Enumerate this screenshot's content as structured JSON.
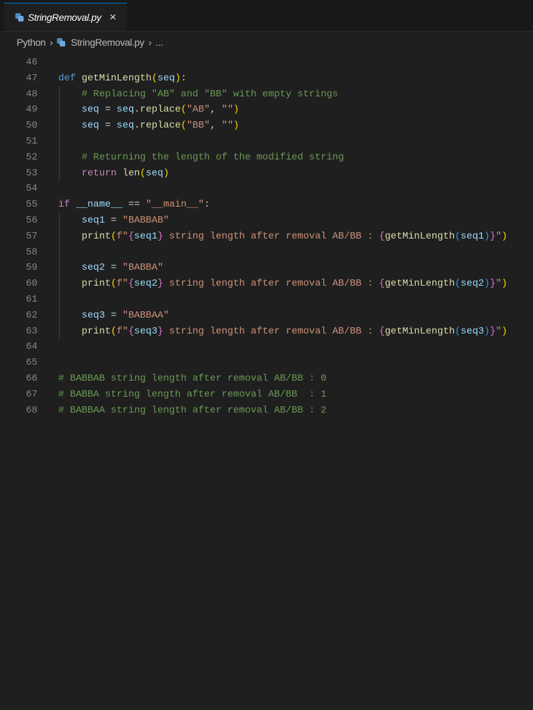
{
  "tab": {
    "filename": "StringRemoval.py",
    "close_icon": "×"
  },
  "breadcrumb": {
    "items": [
      "Python",
      "StringRemoval.py",
      "..."
    ],
    "separator": "›"
  },
  "code": {
    "lines": [
      {
        "n": "46",
        "tokens": []
      },
      {
        "n": "47",
        "tokens": [
          [
            "def",
            "kw"
          ],
          [
            " ",
            "op"
          ],
          [
            "getMinLength",
            "fn"
          ],
          [
            "(",
            "b1"
          ],
          [
            "seq",
            "var"
          ],
          [
            ")",
            "b1"
          ],
          [
            ":",
            "op"
          ]
        ]
      },
      {
        "n": "48",
        "guide": true,
        "tokens": [
          [
            "    ",
            "op"
          ],
          [
            "# Replacing \"AB\" and \"BB\" with empty strings",
            "cm"
          ]
        ]
      },
      {
        "n": "49",
        "guide": true,
        "tokens": [
          [
            "    ",
            "op"
          ],
          [
            "seq",
            "var"
          ],
          [
            " = ",
            "op"
          ],
          [
            "seq",
            "var"
          ],
          [
            ".",
            "op"
          ],
          [
            "replace",
            "fn"
          ],
          [
            "(",
            "b1"
          ],
          [
            "\"AB\"",
            "str"
          ],
          [
            ", ",
            "op"
          ],
          [
            "\"\"",
            "str"
          ],
          [
            ")",
            "b1"
          ]
        ]
      },
      {
        "n": "50",
        "guide": true,
        "tokens": [
          [
            "    ",
            "op"
          ],
          [
            "seq",
            "var"
          ],
          [
            " = ",
            "op"
          ],
          [
            "seq",
            "var"
          ],
          [
            ".",
            "op"
          ],
          [
            "replace",
            "fn"
          ],
          [
            "(",
            "b1"
          ],
          [
            "\"BB\"",
            "str"
          ],
          [
            ", ",
            "op"
          ],
          [
            "\"\"",
            "str"
          ],
          [
            ")",
            "b1"
          ]
        ]
      },
      {
        "n": "51",
        "guide": true,
        "tokens": []
      },
      {
        "n": "52",
        "guide": true,
        "tokens": [
          [
            "    ",
            "op"
          ],
          [
            "# Returning the length of the modified string",
            "cm"
          ]
        ]
      },
      {
        "n": "53",
        "guide": true,
        "tokens": [
          [
            "    ",
            "op"
          ],
          [
            "return",
            "ctl"
          ],
          [
            " ",
            "op"
          ],
          [
            "len",
            "fn"
          ],
          [
            "(",
            "b1"
          ],
          [
            "seq",
            "var"
          ],
          [
            ")",
            "b1"
          ]
        ]
      },
      {
        "n": "54",
        "tokens": []
      },
      {
        "n": "55",
        "tokens": [
          [
            "if",
            "ctl"
          ],
          [
            " ",
            "op"
          ],
          [
            "__name__",
            "var"
          ],
          [
            " == ",
            "op"
          ],
          [
            "\"__main__\"",
            "str"
          ],
          [
            ":",
            "op"
          ]
        ]
      },
      {
        "n": "56",
        "guide": true,
        "tokens": [
          [
            "    ",
            "op"
          ],
          [
            "seq1",
            "var"
          ],
          [
            " = ",
            "op"
          ],
          [
            "\"BABBAB\"",
            "str"
          ]
        ]
      },
      {
        "n": "57",
        "guide": true,
        "tokens": [
          [
            "    ",
            "op"
          ],
          [
            "print",
            "fn"
          ],
          [
            "(",
            "b1"
          ],
          [
            "f\"",
            "str"
          ],
          [
            "{",
            "b2"
          ],
          [
            "seq1",
            "var"
          ],
          [
            "}",
            "b2"
          ],
          [
            " string length after removal AB/BB : ",
            "str"
          ],
          [
            "{",
            "b2"
          ],
          [
            "getMinLength",
            "fn"
          ],
          [
            "(",
            "b3"
          ],
          [
            "seq1",
            "var"
          ],
          [
            ")",
            "b3"
          ],
          [
            "}",
            "b2"
          ],
          [
            "\"",
            "str"
          ],
          [
            ")",
            "b1"
          ]
        ]
      },
      {
        "n": "58",
        "guide": true,
        "tokens": []
      },
      {
        "n": "59",
        "guide": true,
        "tokens": [
          [
            "    ",
            "op"
          ],
          [
            "seq2",
            "var"
          ],
          [
            " = ",
            "op"
          ],
          [
            "\"BABBA\"",
            "str"
          ]
        ]
      },
      {
        "n": "60",
        "guide": true,
        "tokens": [
          [
            "    ",
            "op"
          ],
          [
            "print",
            "fn"
          ],
          [
            "(",
            "b1"
          ],
          [
            "f\"",
            "str"
          ],
          [
            "{",
            "b2"
          ],
          [
            "seq2",
            "var"
          ],
          [
            "}",
            "b2"
          ],
          [
            " string length after removal AB/BB : ",
            "str"
          ],
          [
            "{",
            "b2"
          ],
          [
            "getMinLength",
            "fn"
          ],
          [
            "(",
            "b3"
          ],
          [
            "seq2",
            "var"
          ],
          [
            ")",
            "b3"
          ],
          [
            "}",
            "b2"
          ],
          [
            "\"",
            "str"
          ],
          [
            ")",
            "b1"
          ]
        ]
      },
      {
        "n": "61",
        "guide": true,
        "tokens": []
      },
      {
        "n": "62",
        "guide": true,
        "tokens": [
          [
            "    ",
            "op"
          ],
          [
            "seq3",
            "var"
          ],
          [
            " = ",
            "op"
          ],
          [
            "\"BABBAA\"",
            "str"
          ]
        ]
      },
      {
        "n": "63",
        "guide": true,
        "tokens": [
          [
            "    ",
            "op"
          ],
          [
            "print",
            "fn"
          ],
          [
            "(",
            "b1"
          ],
          [
            "f\"",
            "str"
          ],
          [
            "{",
            "b2"
          ],
          [
            "seq3",
            "var"
          ],
          [
            "}",
            "b2"
          ],
          [
            " string length after removal AB/BB : ",
            "str"
          ],
          [
            "{",
            "b2"
          ],
          [
            "getMinLength",
            "fn"
          ],
          [
            "(",
            "b3"
          ],
          [
            "seq3",
            "var"
          ],
          [
            ")",
            "b3"
          ],
          [
            "}",
            "b2"
          ],
          [
            "\"",
            "str"
          ],
          [
            ")",
            "b1"
          ]
        ]
      },
      {
        "n": "64",
        "tokens": []
      },
      {
        "n": "65",
        "tokens": []
      },
      {
        "n": "66",
        "tokens": [
          [
            "# BABBAB string length after removal AB/BB : 0",
            "cm"
          ]
        ]
      },
      {
        "n": "67",
        "tokens": [
          [
            "# BABBA string length after removal AB/BB  : 1",
            "cm"
          ]
        ]
      },
      {
        "n": "68",
        "tokens": [
          [
            "# BABBAA string length after removal AB/BB : 2",
            "cm"
          ]
        ]
      }
    ]
  }
}
